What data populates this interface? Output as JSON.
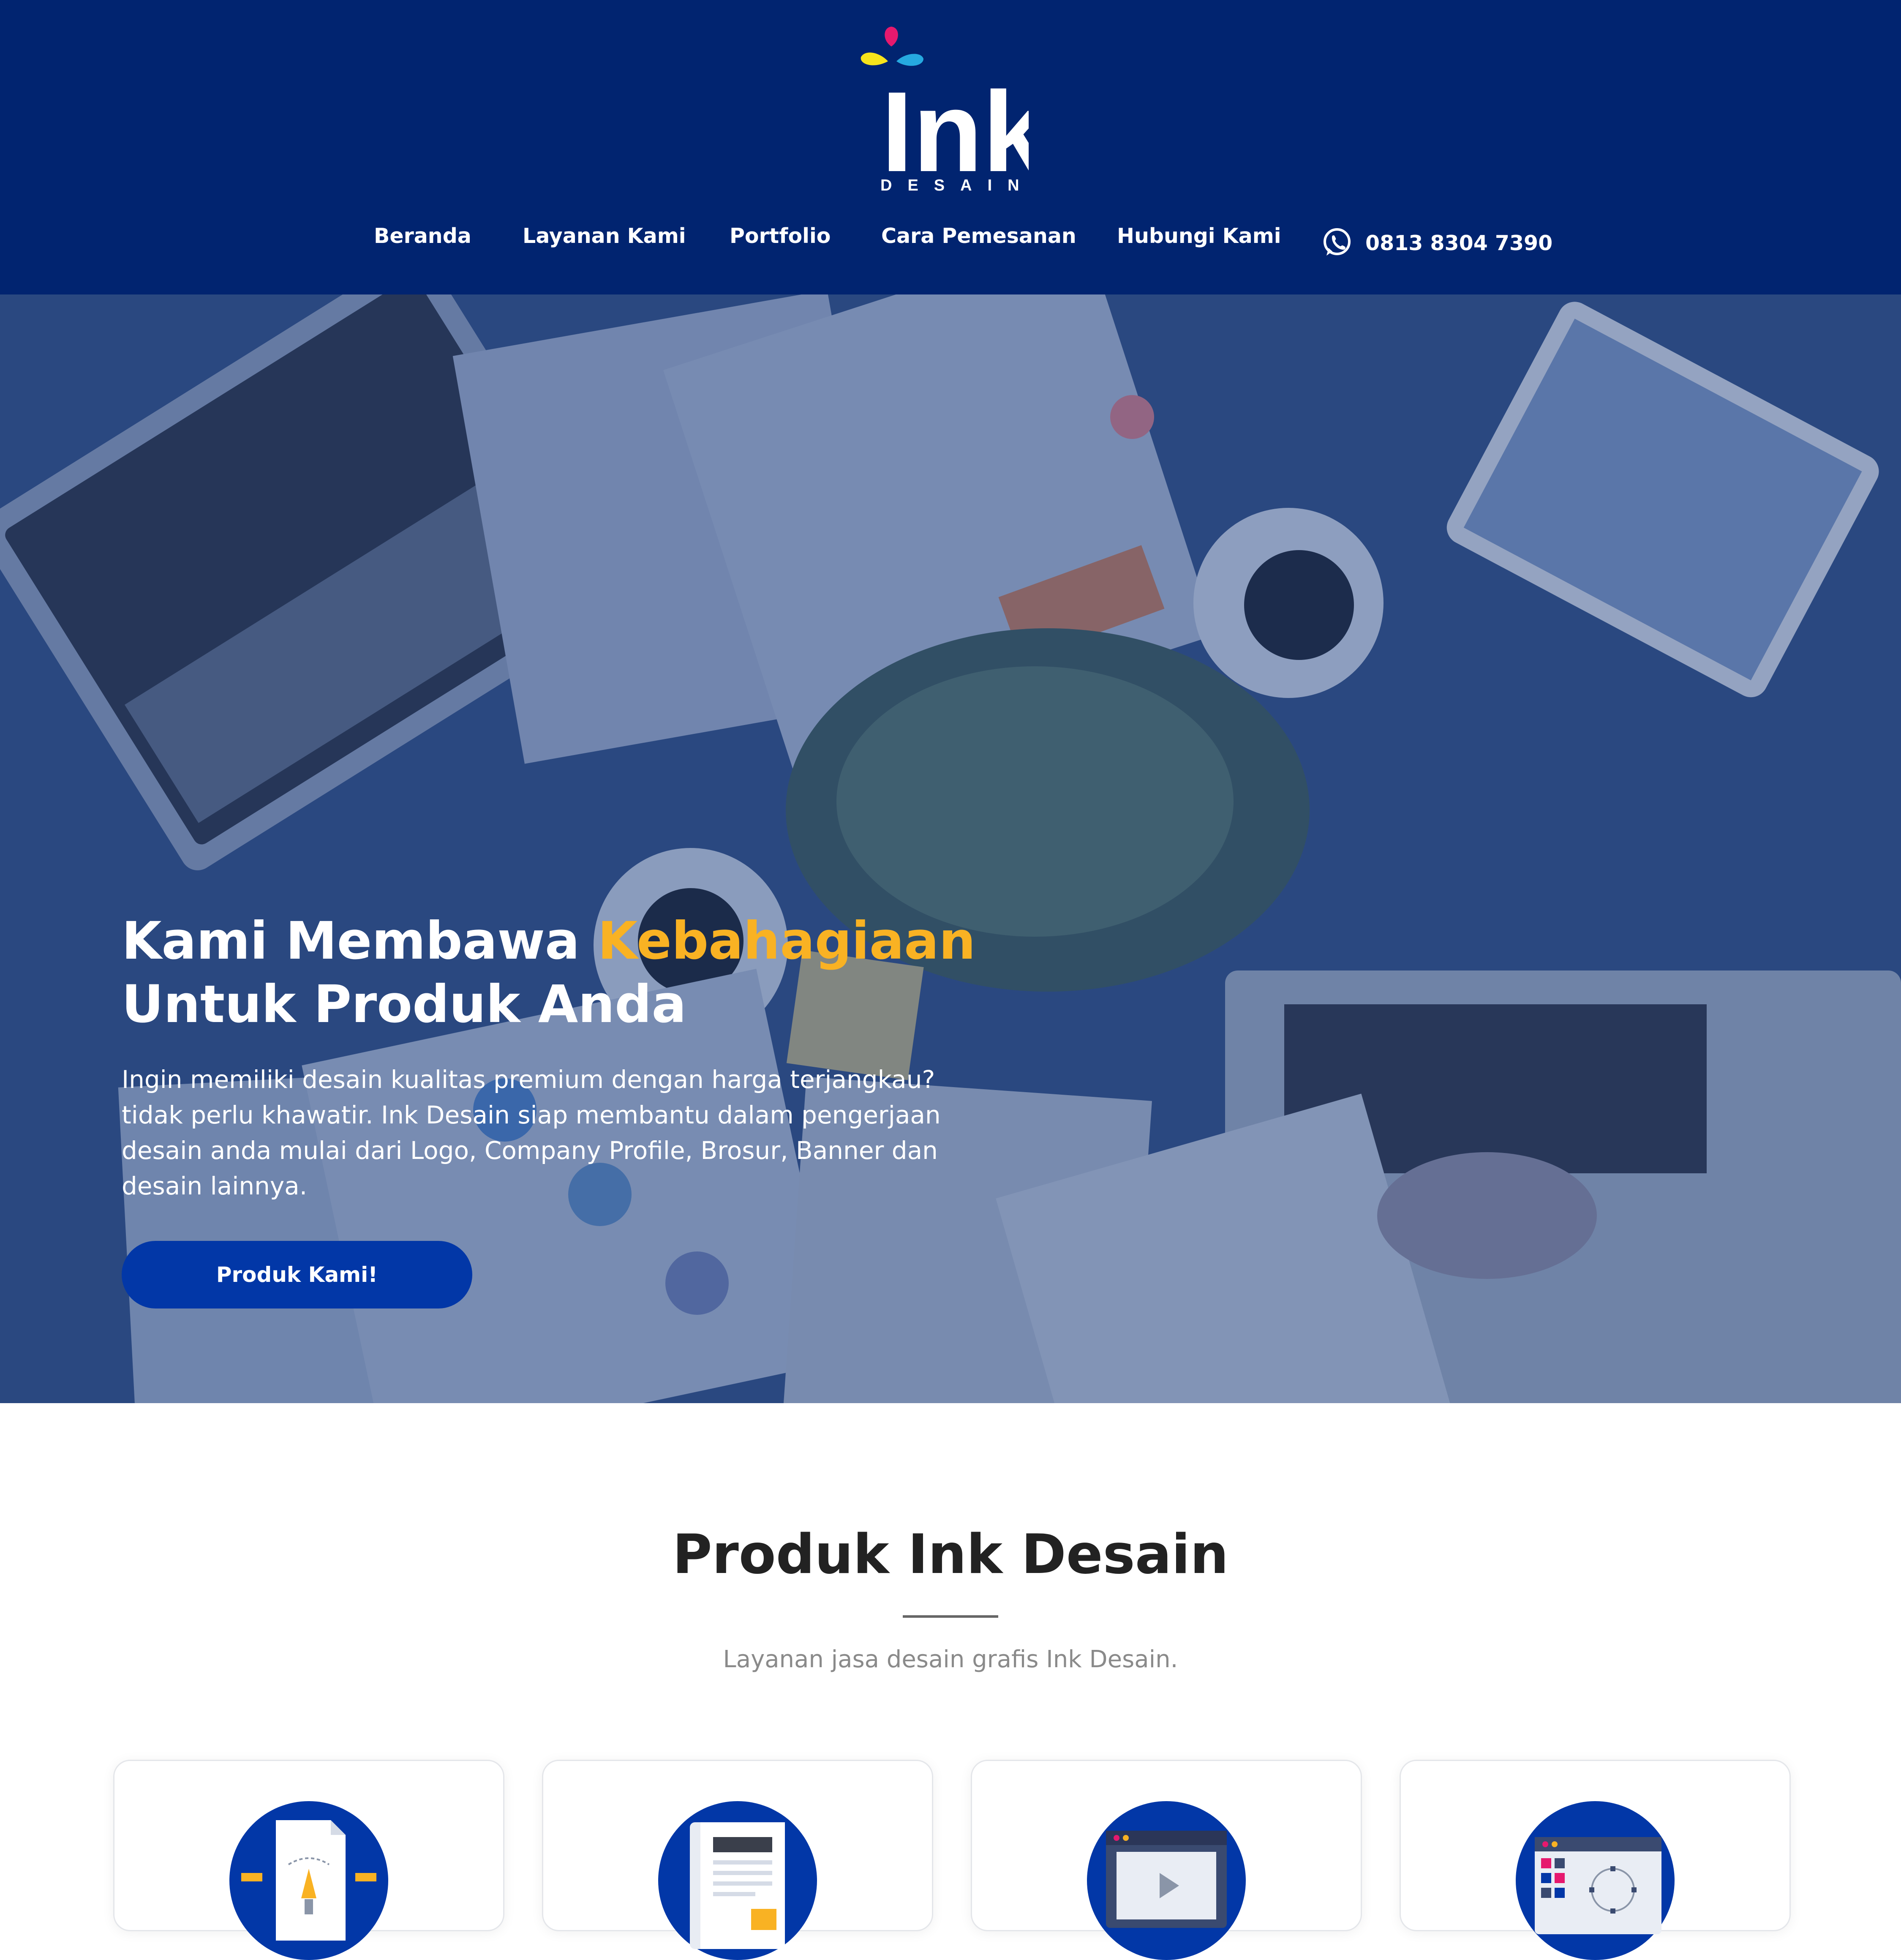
{
  "brand": {
    "name": "Ink",
    "tagline": "DESAIN",
    "colors": {
      "navy": "#012470",
      "accent": "#f9b223",
      "button": "#0237a7",
      "magenta": "#e6196e",
      "cyan": "#26a9e0",
      "yellow": "#f7e41b"
    }
  },
  "nav": {
    "items": [
      {
        "label": "Beranda"
      },
      {
        "label": "Layanan Kami"
      },
      {
        "label": "Portfolio"
      },
      {
        "label": "Cara Pemesanan"
      },
      {
        "label": "Hubungi Kami"
      }
    ],
    "phone": {
      "icon": "whatsapp-icon",
      "number": "0813 8304 7390"
    }
  },
  "hero": {
    "title_part1": "Kami Membawa ",
    "title_accent": "Kebahagiaan",
    "title_part2": "Untuk Produk Anda",
    "description": "Ingin memiliki desain kualitas premium dengan harga terjangkau? tidak perlu khawatir. Ink Desain siap membantu dalam pengerjaan desain anda mulai dari Logo, Company Profile, Brosur, Banner dan desain lainnya.",
    "button_label": "Produk Kami!"
  },
  "products": {
    "title": "Produk Ink Desain",
    "subtitle": "Layanan jasa desain grafis Ink Desain.",
    "cards": [
      {
        "icon": "vector-design-icon"
      },
      {
        "icon": "document-brochure-icon"
      },
      {
        "icon": "video-player-icon"
      },
      {
        "icon": "web-layout-icon"
      }
    ]
  }
}
